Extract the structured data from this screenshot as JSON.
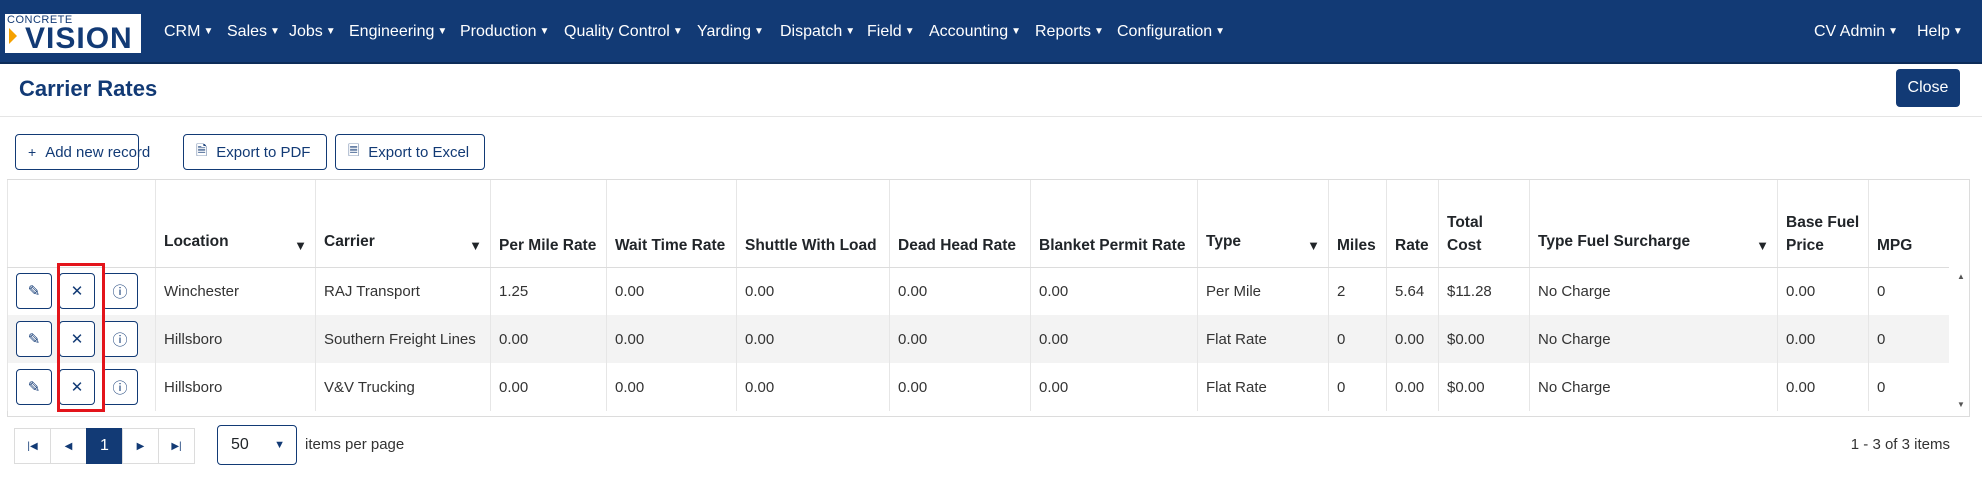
{
  "logo": {
    "small": "CONCRETE",
    "big": "VISION"
  },
  "nav": {
    "items": [
      "CRM",
      "Sales",
      "Jobs",
      "Engineering",
      "Production",
      "Quality Control",
      "Yarding",
      "Dispatch",
      "Field",
      "Accounting",
      "Reports",
      "Configuration"
    ],
    "user": "CV Admin",
    "help": "Help"
  },
  "page": {
    "title": "Carrier Rates",
    "close_label": "Close"
  },
  "toolbar": {
    "add": "Add new record",
    "pdf": "Export to PDF",
    "excel": "Export to Excel"
  },
  "grid": {
    "columns": [
      {
        "label": "Location",
        "filter": true
      },
      {
        "label": "Carrier",
        "filter": true
      },
      {
        "label": "Per Mile Rate",
        "filter": false
      },
      {
        "label": "Wait Time Rate",
        "filter": false
      },
      {
        "label": "Shuttle With Load",
        "filter": false
      },
      {
        "label": "Dead Head Rate",
        "filter": false
      },
      {
        "label": "Blanket Permit Rate",
        "filter": false
      },
      {
        "label": "Type",
        "filter": true
      },
      {
        "label": "Miles",
        "filter": false
      },
      {
        "label": "Rate",
        "filter": false
      },
      {
        "label": "Total Cost",
        "filter": false
      },
      {
        "label": "Type Fuel Surcharge",
        "filter": true
      },
      {
        "label": "Base Fuel Price",
        "filter": false
      },
      {
        "label": "MPG",
        "filter": false
      }
    ],
    "rows": [
      [
        "Winchester",
        "RAJ Transport",
        "1.25",
        "0.00",
        "0.00",
        "0.00",
        "0.00",
        "Per Mile",
        "2",
        "5.64",
        "$11.28",
        "No Charge",
        "0.00",
        "0"
      ],
      [
        "Hillsboro",
        "Southern Freight Lines",
        "0.00",
        "0.00",
        "0.00",
        "0.00",
        "0.00",
        "Flat Rate",
        "0",
        "0.00",
        "$0.00",
        "No Charge",
        "0.00",
        "0"
      ],
      [
        "Hillsboro",
        "V&V Trucking",
        "0.00",
        "0.00",
        "0.00",
        "0.00",
        "0.00",
        "Flat Rate",
        "0",
        "0.00",
        "$0.00",
        "No Charge",
        "0.00",
        "0"
      ]
    ]
  },
  "pager": {
    "current_page": "1",
    "page_size": "50",
    "items_per_page_label": "items per page",
    "info": "1 - 3 of 3 items"
  },
  "colors": {
    "primary": "#123a75",
    "highlight": "#e3141b"
  },
  "icons": [
    "edit-icon",
    "delete-icon",
    "info-icon",
    "filter-icon",
    "plus-icon",
    "pdf-icon",
    "excel-icon"
  ]
}
